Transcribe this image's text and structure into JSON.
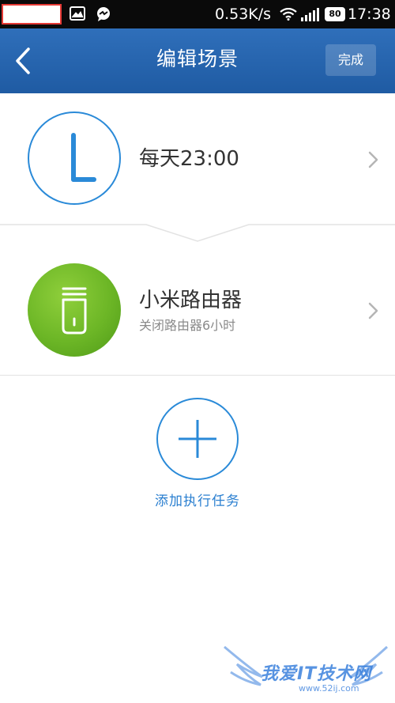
{
  "status_bar": {
    "network_speed": "0.53K/s",
    "battery": "80",
    "time": "17:38",
    "icons": [
      "image-notification-icon",
      "chat-notification-icon",
      "wifi-icon",
      "signal-icon",
      "battery-icon"
    ]
  },
  "header": {
    "title": "编辑场景",
    "done_label": "完成",
    "back_icon": "chevron-left-icon"
  },
  "trigger": {
    "icon": "clock-icon",
    "label": "每天23:00"
  },
  "action": {
    "icon": "router-icon",
    "title": "小米路由器",
    "subtitle": "关闭路由器6小时"
  },
  "add_task": {
    "icon": "plus-icon",
    "label": "添加执行任务"
  },
  "watermark": {
    "text": "我爱IT技术网",
    "url": "www.52ij.com"
  },
  "colors": {
    "header": "#2566b0",
    "accent": "#2a8ad8",
    "router_green": "#6cb626",
    "highlight_box": "#e53935"
  }
}
